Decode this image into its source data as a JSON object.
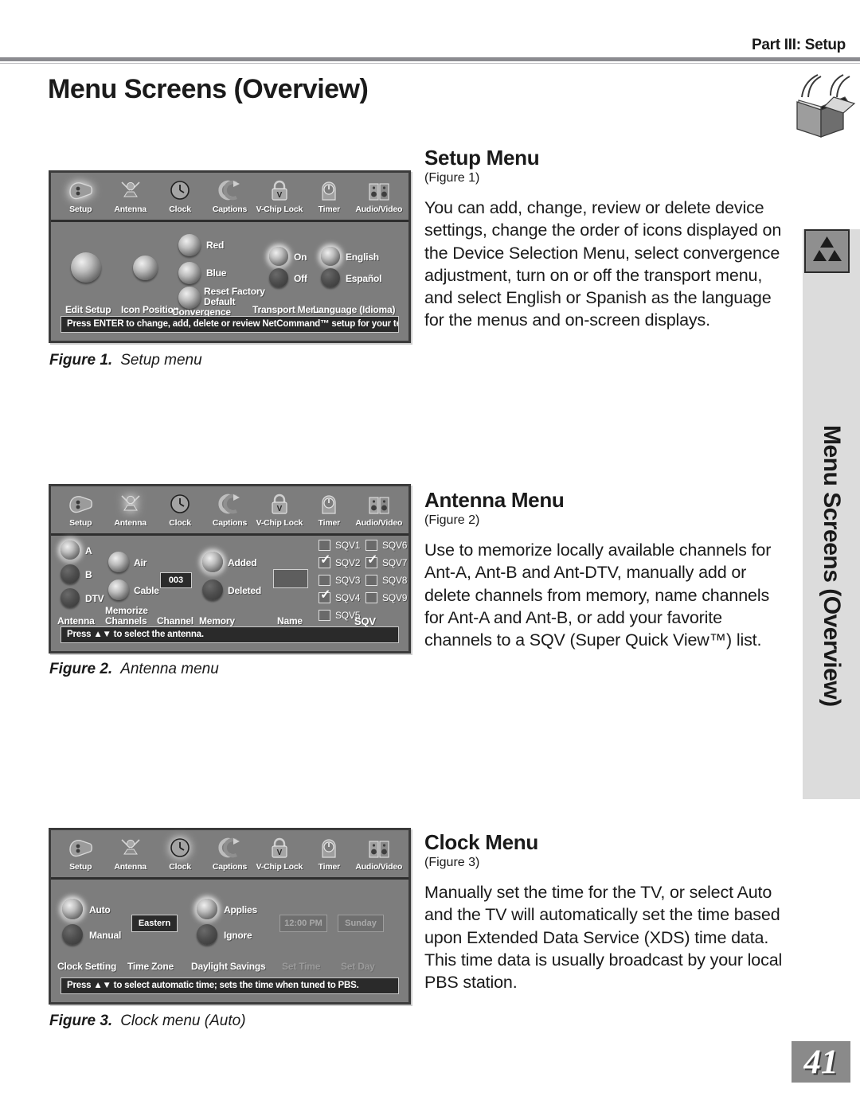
{
  "header": {
    "part_label": "Part III: Setup",
    "page_title": "Menu Screens (Overview)",
    "box_icon": "open-box-icon"
  },
  "side_tab": {
    "vertical_text": "Menu Screens (Overview)",
    "logo": "mitsubishi-three-diamond-logo"
  },
  "page_number": "41",
  "menu_bar": {
    "items": [
      {
        "label": "Setup",
        "icon": "plug-icon"
      },
      {
        "label": "Antenna",
        "icon": "antenna-icon"
      },
      {
        "label": "Clock",
        "icon": "clock-icon"
      },
      {
        "label": "Captions",
        "icon": "captions-icon"
      },
      {
        "label": "V-Chip Lock",
        "icon": "padlock-icon"
      },
      {
        "label": "Timer",
        "icon": "timer-icon"
      },
      {
        "label": "Audio/Video",
        "icon": "speakers-icon"
      }
    ]
  },
  "figures": [
    {
      "id": "figure-1",
      "caption_label": "Figure 1.",
      "caption_text": "Setup menu",
      "selected_menu": "Setup",
      "status_bar": "Press ENTER to change, add, delete or review NetCommand™ setup for your television.",
      "groups": [
        {
          "name": "Edit Setup",
          "label": "Edit Setup"
        },
        {
          "name": "Icon Position",
          "label": "Icon Position"
        },
        {
          "name": "Convergence",
          "label": "Convergence",
          "options": [
            "Red",
            "Blue",
            "Reset Factory Default"
          ]
        },
        {
          "name": "Transport Menu",
          "label": "Transport Menu",
          "options": [
            "On",
            "Off"
          ],
          "selected": "On"
        },
        {
          "name": "Language (Idioma)",
          "label": "Language (Idioma)",
          "options": [
            "English",
            "Español"
          ],
          "selected": "English"
        }
      ]
    },
    {
      "id": "figure-2",
      "caption_label": "Figure 2.",
      "caption_text": "Antenna menu",
      "selected_menu": "Antenna",
      "status_bar": "Press ▲▼ to select the antenna.",
      "groups": [
        {
          "name": "Antenna",
          "label": "Antenna",
          "options": [
            "A",
            "B",
            "DTV"
          ],
          "selected": "A"
        },
        {
          "name": "Memorize Channels",
          "label_line1": "Memorize",
          "label_line2": "Channels",
          "options": [
            "Air",
            "Cable"
          ]
        },
        {
          "name": "Channel",
          "label": "Channel",
          "value": "003"
        },
        {
          "name": "Memory",
          "label": "Memory",
          "options": [
            "Added",
            "Deleted"
          ],
          "selected": "Added"
        },
        {
          "name": "Name",
          "label": "Name",
          "value": ""
        },
        {
          "name": "SQV",
          "label": "SQV",
          "checkboxes": [
            {
              "label": "SQV1",
              "checked": false
            },
            {
              "label": "SQV2",
              "checked": true
            },
            {
              "label": "SQV3",
              "checked": false
            },
            {
              "label": "SQV4",
              "checked": true
            },
            {
              "label": "SQV5",
              "checked": false
            },
            {
              "label": "SQV6",
              "checked": false
            },
            {
              "label": "SQV7",
              "checked": true
            },
            {
              "label": "SQV8",
              "checked": false
            },
            {
              "label": "SQV9",
              "checked": false
            }
          ]
        }
      ]
    },
    {
      "id": "figure-3",
      "caption_label": "Figure 3.",
      "caption_text": "Clock menu (Auto)",
      "selected_menu": "Clock",
      "status_bar": "Press ▲▼ to select automatic time; sets the time when tuned to PBS.",
      "groups": [
        {
          "name": "Clock Setting",
          "label": "Clock Setting",
          "options": [
            "Auto",
            "Manual"
          ],
          "selected": "Auto"
        },
        {
          "name": "Time Zone",
          "label": "Time Zone",
          "value": "Eastern"
        },
        {
          "name": "Daylight Savings",
          "label": "Daylight Savings",
          "options": [
            "Applies",
            "Ignore"
          ],
          "selected": "Applies"
        },
        {
          "name": "Set Time",
          "label": "Set Time",
          "value": "12:00 PM",
          "disabled": true
        },
        {
          "name": "Set Day",
          "label": "Set Day",
          "value": "Sunday",
          "disabled": true
        }
      ]
    }
  ],
  "sections": [
    {
      "heading": "Setup Menu",
      "figref": "(Figure 1)",
      "body": "You can add, change, review or delete device settings, change the order of icons displayed on the Device Selection Menu, select convergence adjustment, turn on or off the transport menu, and select English or Spanish as the language for the menus and on-screen displays."
    },
    {
      "heading": "Antenna Menu",
      "figref": "(Figure 2)",
      "body": "Use to memorize locally available channels for Ant-A, Ant-B and Ant-DTV, manually add or delete channels from memory, name channels for Ant-A and Ant-B, or add your favorite channels to a SQV (Super Quick View™) list."
    },
    {
      "heading": "Clock Menu",
      "figref": "(Figure 3)",
      "body": "Manually set the time for the TV, or select Auto and the TV will automatically set the time based upon Extended Data Service (XDS) time data.  This time data is usually broadcast by your local PBS station."
    }
  ]
}
